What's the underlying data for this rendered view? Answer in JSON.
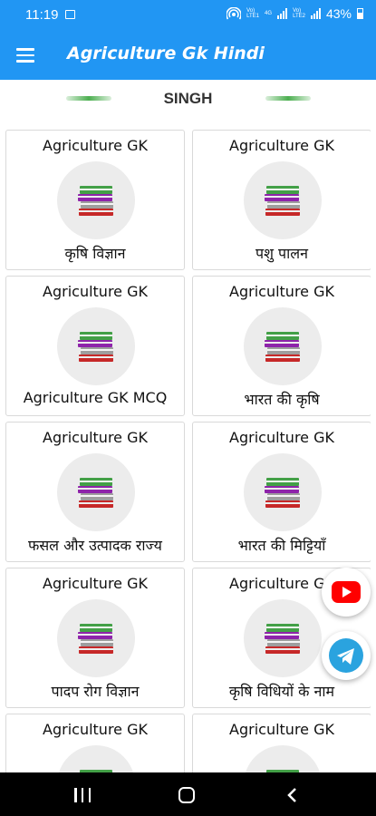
{
  "status_bar": {
    "time": "11:19",
    "network_top": "Vo)",
    "network_bottom": "LTE1",
    "network_top_2": "Vo)",
    "network_bottom_2": "LTE2",
    "data_label": "4G",
    "battery": "43%"
  },
  "app_bar": {
    "title": "Agriculture Gk Hindi",
    "menu_icon": "hamburger-menu-icon",
    "color": "#2196F3"
  },
  "header": {
    "label": "SINGH",
    "accent": "#4CAF50"
  },
  "cards": [
    {
      "heading": "Agriculture GK",
      "title": "कृषि विज्ञान"
    },
    {
      "heading": "Agriculture GK",
      "title": "पशु पालन"
    },
    {
      "heading": "Agriculture GK",
      "title": "Agriculture GK MCQ"
    },
    {
      "heading": "Agriculture GK",
      "title": "भारत की कृषि"
    },
    {
      "heading": "Agriculture GK",
      "title": "फसल और उत्पादक राज्य"
    },
    {
      "heading": "Agriculture GK",
      "title": "भारत की मिट्टियाँ"
    },
    {
      "heading": "Agriculture GK",
      "title": "पादप रोग विज्ञान"
    },
    {
      "heading": "Agriculture GK",
      "title": "कृषि विधियों के नाम"
    },
    {
      "heading": "Agriculture GK",
      "title": ""
    },
    {
      "heading": "Agriculture GK",
      "title": ""
    }
  ],
  "fabs": {
    "youtube_icon": "youtube-icon",
    "telegram_icon": "telegram-icon"
  },
  "nav_bar": {
    "recent": "recent-apps-icon",
    "home": "home-icon",
    "back": "back-icon"
  }
}
